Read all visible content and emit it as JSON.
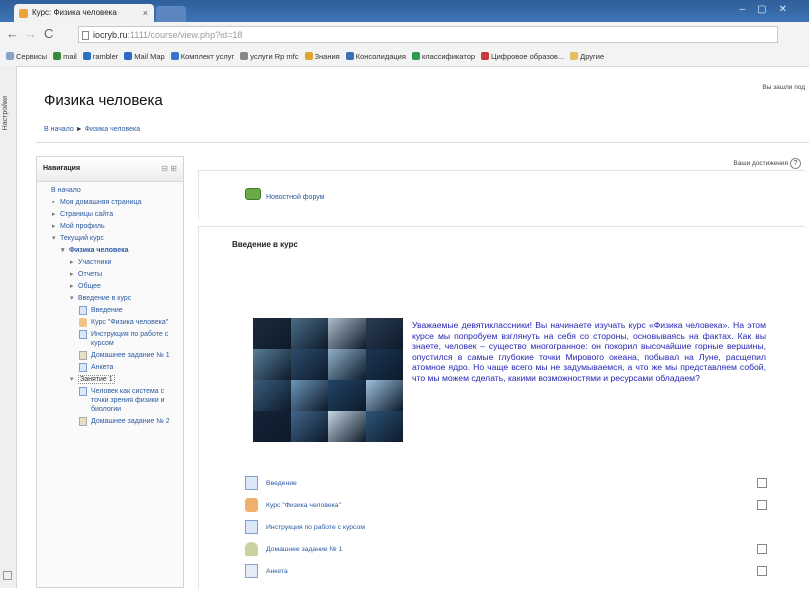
{
  "browser": {
    "tab_title": "Курс: Физика человека",
    "tab_close": "×",
    "url_host": "iocryb.ru",
    "url_path": ":1111/course/view.php?id=18",
    "bookmarks": [
      {
        "label": "Сервисы",
        "color": "#8aa1c8"
      },
      {
        "label": "mail",
        "color": "#3b8a3b"
      },
      {
        "label": "rambler",
        "color": "#2a73c6"
      },
      {
        "label": "Mail Map",
        "color": "#2b6cc2"
      },
      {
        "label": "Комплект услуг",
        "color": "#3575c8"
      },
      {
        "label": "услуги Rp mfc",
        "color": "#888888"
      },
      {
        "label": "Знания",
        "color": "#e0a42e"
      },
      {
        "label": "Консолидация",
        "color": "#3b6fb8"
      },
      {
        "label": "классификатор",
        "color": "#2e9a55"
      },
      {
        "label": "Цифровое образов...",
        "color": "#c83a3a"
      },
      {
        "label": "Другие",
        "color": "#e0c060"
      }
    ]
  },
  "dock": {
    "label": "Настройки"
  },
  "page": {
    "title": "Физика человека",
    "login_info": "Вы зашли под",
    "breadcrumb_home": "В начало",
    "breadcrumb_sep": "►",
    "breadcrumb_course": "Физика человека"
  },
  "nav": {
    "title": "Навигация",
    "controls": "⊟ ⊞",
    "items": [
      {
        "label": "В начало",
        "indent": 0,
        "bullet": "",
        "bold": false
      },
      {
        "label": "Моя домашняя страница",
        "indent": 1,
        "bullet": "▪",
        "bold": false
      },
      {
        "label": "Страницы сайта",
        "indent": 1,
        "bullet": "▸",
        "bold": false
      },
      {
        "label": "Мой профиль",
        "indent": 1,
        "bullet": "▸",
        "bold": false
      },
      {
        "label": "Текущий курс",
        "indent": 1,
        "bullet": "▾",
        "bold": false
      },
      {
        "label": "Физика человека",
        "indent": 2,
        "bullet": "▾",
        "bold": true
      },
      {
        "label": "Участники",
        "indent": 3,
        "bullet": "▸",
        "bold": false
      },
      {
        "label": "Отчеты",
        "indent": 3,
        "bullet": "▸",
        "bold": false
      },
      {
        "label": "Общее",
        "indent": 3,
        "bullet": "▸",
        "bold": false
      },
      {
        "label": "Введение в курс",
        "indent": 3,
        "bullet": "▾",
        "bold": false
      },
      {
        "label": "Введение",
        "indent": 4,
        "icon": "page"
      },
      {
        "label": "Курс \"Физика человека\"",
        "indent": 4,
        "icon": "res"
      },
      {
        "label": "Инструкция по работе с курсом",
        "indent": 4,
        "icon": "page"
      },
      {
        "label": "Домашнее задание № 1",
        "indent": 4,
        "icon": "quest"
      },
      {
        "label": "Анкета",
        "indent": 4,
        "icon": "page"
      },
      {
        "label": "Занятие 1",
        "indent": 3,
        "bullet": "▾",
        "boxed": true
      },
      {
        "label": "Человек как система с точки зрения физики и биологии",
        "indent": 4,
        "icon": "page"
      },
      {
        "label": "Домашнее задание № 2",
        "indent": 4,
        "icon": "quest"
      }
    ]
  },
  "main": {
    "edit_label": "Ваши достижения",
    "help": "?",
    "forum_link": "Новостной форум",
    "section_title": "Введение в курс",
    "intro": "Уважаемые девятиклассники! Вы начинаете изучать курс «Физика человека». На этом курсе мы попробуем взглянуть на себя со стороны, основываясь на фактах. Как вы знаете, человек – существо многогранное: он покорил высочайшие горные вершины, опустился в самые глубокие точки Мирового океана, побывал на Луне, расщепил атомное ядро. Но чаще всего мы не задумываемся, а что же мы представляем собой, что мы можем сделать, какими возможностями и ресурсами обладаем?",
    "activities": [
      {
        "label": "Введение",
        "icon": "page",
        "checkbox": true
      },
      {
        "label": "Курс \"Физика человека\"",
        "icon": "res",
        "checkbox": true
      },
      {
        "label": "Инструкция по работе с курсом",
        "icon": "page",
        "checkbox": false
      },
      {
        "label": "Домашнее задание № 1",
        "icon": "assign",
        "checkbox": true
      },
      {
        "label": "Анкета",
        "icon": "quest",
        "checkbox": true
      }
    ],
    "collage_colors": [
      "#1d2a3c",
      "#4a6d86",
      "#aebccb",
      "#2a3c52",
      "#587e9a",
      "#2d4c6d",
      "#8fb0c8",
      "#1b3555",
      "#3a5c7d",
      "#6b95b8",
      "#234466",
      "#9ec1dc",
      "#142338",
      "#41658a",
      "#c6d7e5",
      "#2e5478"
    ]
  }
}
